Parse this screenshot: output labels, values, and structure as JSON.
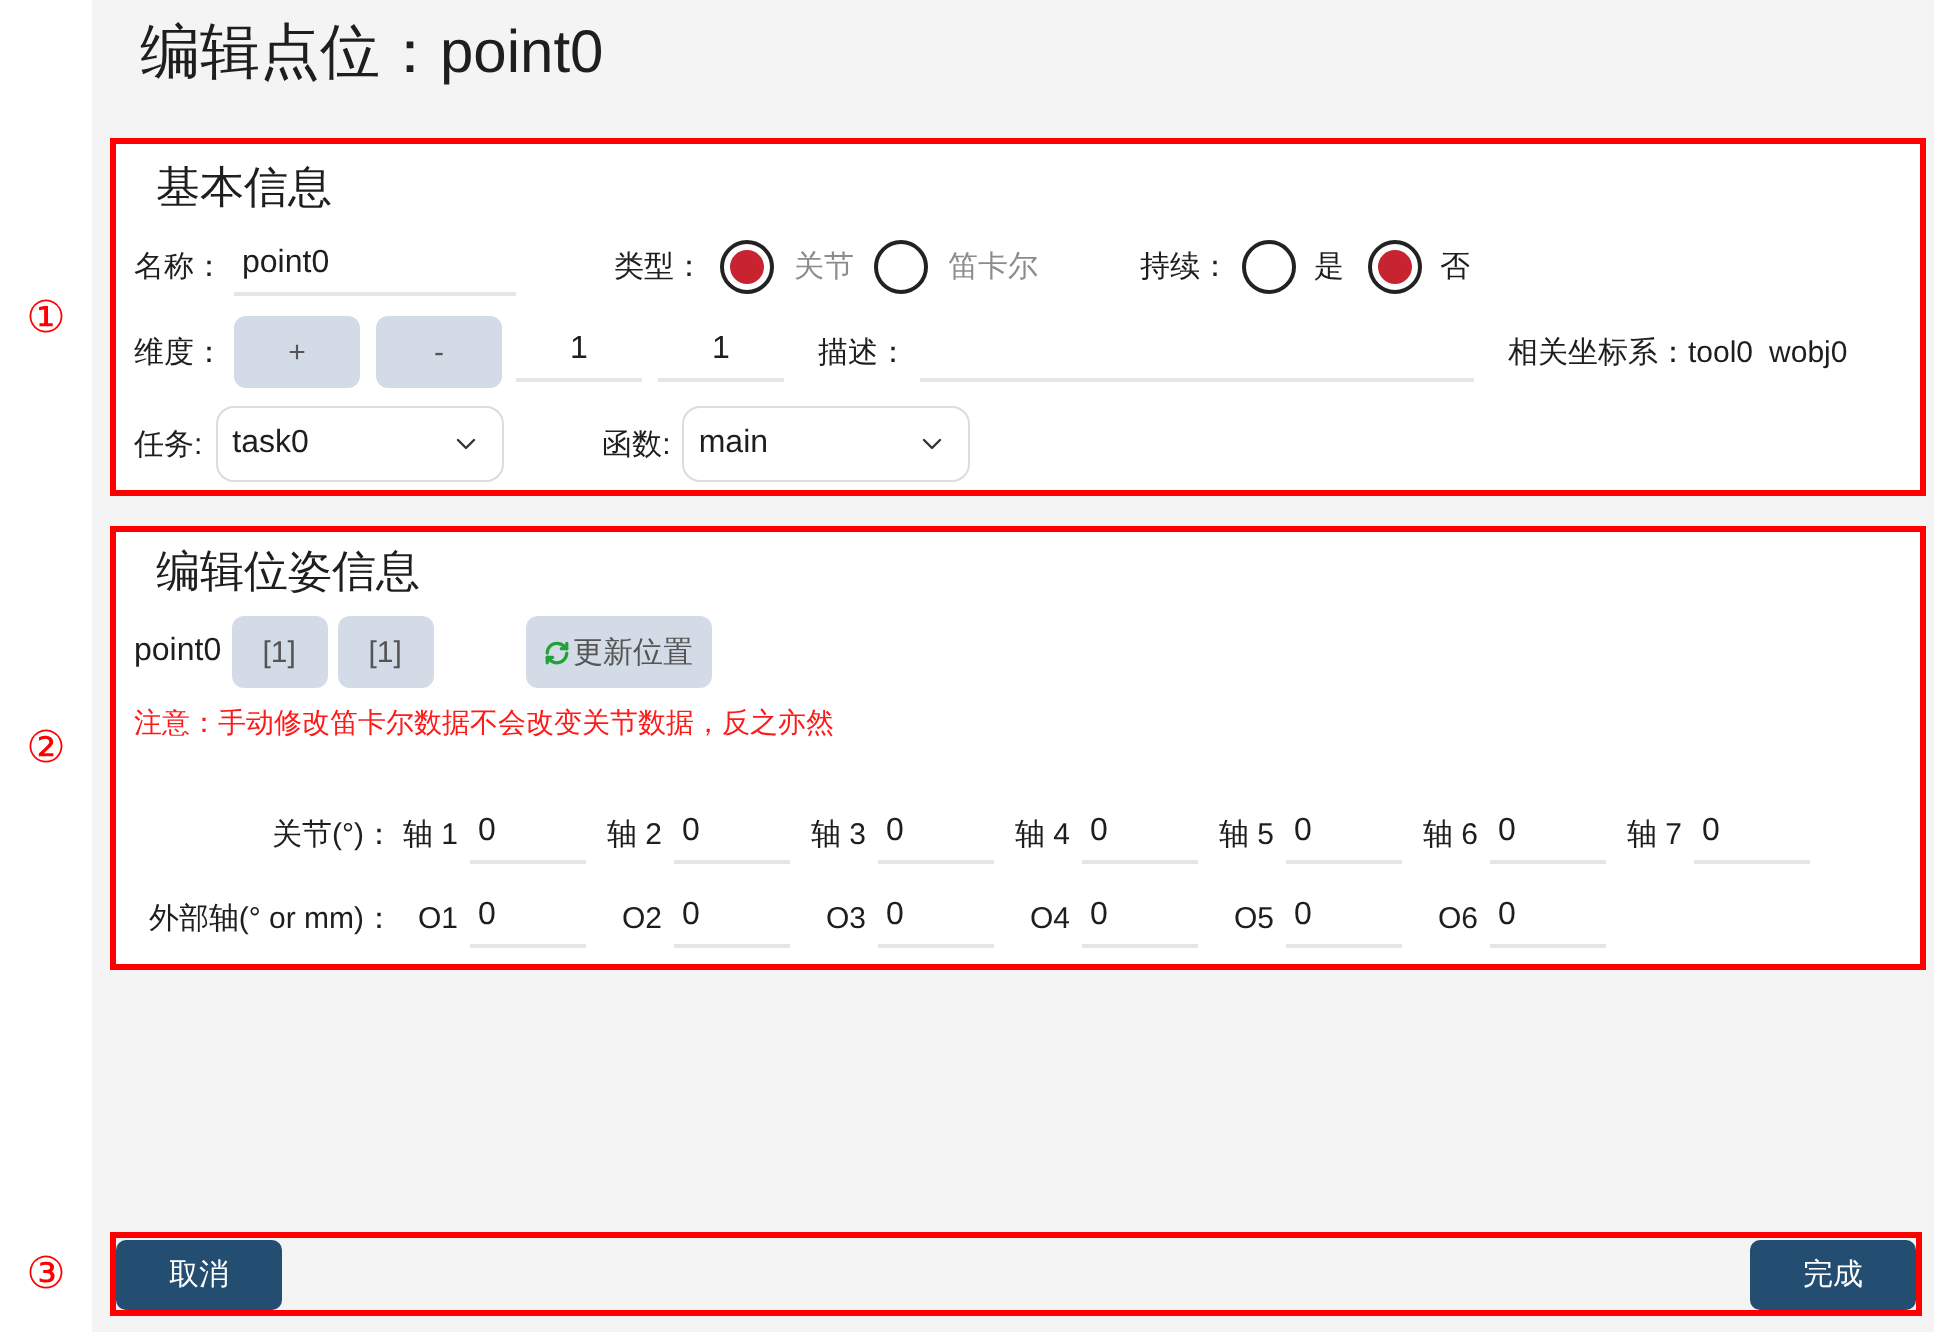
{
  "title": "编辑点位：point0",
  "basic_info": {
    "marker": "①",
    "heading": "基本信息",
    "name": {
      "label": "名称：",
      "value": "point0"
    },
    "type": {
      "label": "类型：",
      "disabled": true,
      "options": [
        {
          "label": "关节",
          "selected": true
        },
        {
          "label": "笛卡尔",
          "selected": false
        }
      ]
    },
    "continuous": {
      "label": "持续：",
      "disabled": false,
      "options": [
        {
          "label": "是",
          "selected": false
        },
        {
          "label": "否",
          "selected": true
        }
      ]
    },
    "dimension": {
      "label": "维度：",
      "buttons": [
        "+",
        "-"
      ],
      "values": [
        "1",
        "1"
      ]
    },
    "description": {
      "label": "描述："
    },
    "coordinate_systems": {
      "label": "相关坐标系：",
      "values": [
        "tool0",
        "wobj0"
      ]
    },
    "task": {
      "label": "任务:",
      "value": "task0"
    },
    "function": {
      "label": "函数:",
      "value": "main"
    }
  },
  "pose_info": {
    "marker": "②",
    "heading": "编辑位姿信息",
    "point": "point0",
    "index_buttons": [
      "[1]",
      "[1]"
    ],
    "update_button": "更新位置",
    "note": "注意：手动修改笛卡尔数据不会改变关节数据，反之亦然",
    "rows": [
      {
        "label": "关节(°)：",
        "fields": [
          {
            "label": "轴 1",
            "value": "0"
          },
          {
            "label": "轴 2",
            "value": "0"
          },
          {
            "label": "轴 3",
            "value": "0"
          },
          {
            "label": "轴 4",
            "value": "0"
          },
          {
            "label": "轴 5",
            "value": "0"
          },
          {
            "label": "轴 6",
            "value": "0"
          },
          {
            "label": "轴 7",
            "value": "0"
          }
        ]
      },
      {
        "label": "外部轴(° or mm)：",
        "fields": [
          {
            "label": "O1",
            "value": "0"
          },
          {
            "label": "O2",
            "value": "0"
          },
          {
            "label": "O3",
            "value": "0"
          },
          {
            "label": "O4",
            "value": "0"
          },
          {
            "label": "O5",
            "value": "0"
          },
          {
            "label": "O6",
            "value": "0"
          }
        ]
      }
    ]
  },
  "footer": {
    "marker": "③",
    "buttons": [
      "取消",
      "完成"
    ]
  }
}
